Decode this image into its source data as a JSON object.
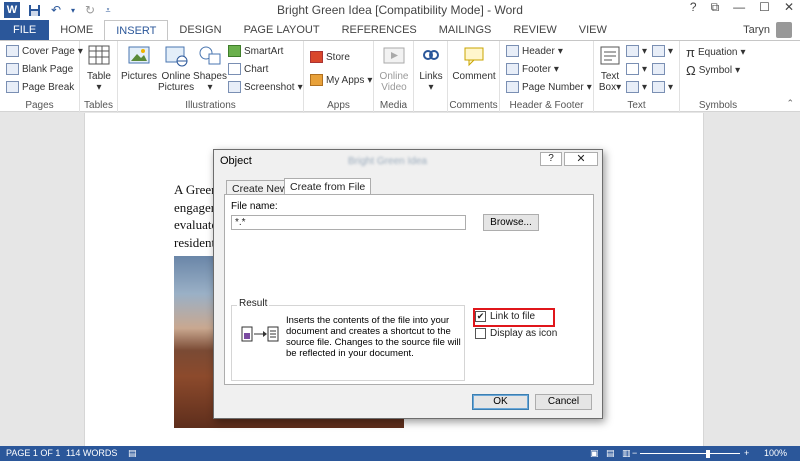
{
  "window": {
    "title": "Bright Green Idea [Compatibility Mode] - Word",
    "controls": [
      "?",
      "⧉",
      "—",
      "☐",
      "✕"
    ]
  },
  "user": "Taryn",
  "tabs": [
    "FILE",
    "HOME",
    "INSERT",
    "DESIGN",
    "PAGE LAYOUT",
    "REFERENCES",
    "MAILINGS",
    "REVIEW",
    "VIEW"
  ],
  "active_tab": "INSERT",
  "ribbon": {
    "pages": {
      "label": "Pages",
      "items": [
        "Cover Page",
        "Blank Page",
        "Page Break"
      ]
    },
    "tables": {
      "label": "Tables",
      "table": "Table"
    },
    "illustrations": {
      "label": "Illustrations",
      "pictures": "Pictures",
      "online_pictures_1": "Online",
      "online_pictures_2": "Pictures",
      "shapes": "Shapes",
      "smartart": "SmartArt",
      "chart": "Chart",
      "screenshot": "Screenshot"
    },
    "apps": {
      "label": "Apps",
      "store": "Store",
      "my_apps": "My Apps"
    },
    "media": {
      "label": "Media",
      "online_video_1": "Online",
      "online_video_2": "Video"
    },
    "links": {
      "label": "Links"
    },
    "comments": {
      "label": "Comments",
      "comment": "Comment"
    },
    "header_footer": {
      "label": "Header & Footer",
      "header": "Header",
      "footer": "Footer",
      "page_number": "Page Number"
    },
    "text": {
      "label": "Text",
      "text_box_1": "Text",
      "text_box_2": "Box"
    },
    "symbols": {
      "label": "Symbols",
      "equation": "Equation",
      "symbol": "Symbol"
    }
  },
  "document": {
    "lines": [
      "A Green",
      "engager",
      "evaluate",
      "resident"
    ]
  },
  "dialog": {
    "title": "Object",
    "blurred_title": "Bright Green Idea",
    "tab_create_new": "Create New",
    "tab_create_from_file": "Create from File",
    "file_name_label": "File name:",
    "file_name_value": "*.*",
    "browse_button": "Browse...",
    "link_to_file": "Link to file",
    "link_to_file_checked": true,
    "display_as_icon": "Display as icon",
    "display_as_icon_checked": false,
    "result_label": "Result",
    "result_text": "Inserts the contents of the file into your document and creates a shortcut to the source file. Changes to the source file will be reflected in your document.",
    "ok_button": "OK",
    "cancel_button": "Cancel",
    "help_button": "?",
    "close_button": "✕"
  },
  "status": {
    "page": "PAGE 1 OF 1",
    "words": "114 WORDS",
    "zoom": "100%",
    "zoom_level": 1.0
  },
  "colors": {
    "accent": "#2b579a",
    "highlight": "#e0161b"
  }
}
